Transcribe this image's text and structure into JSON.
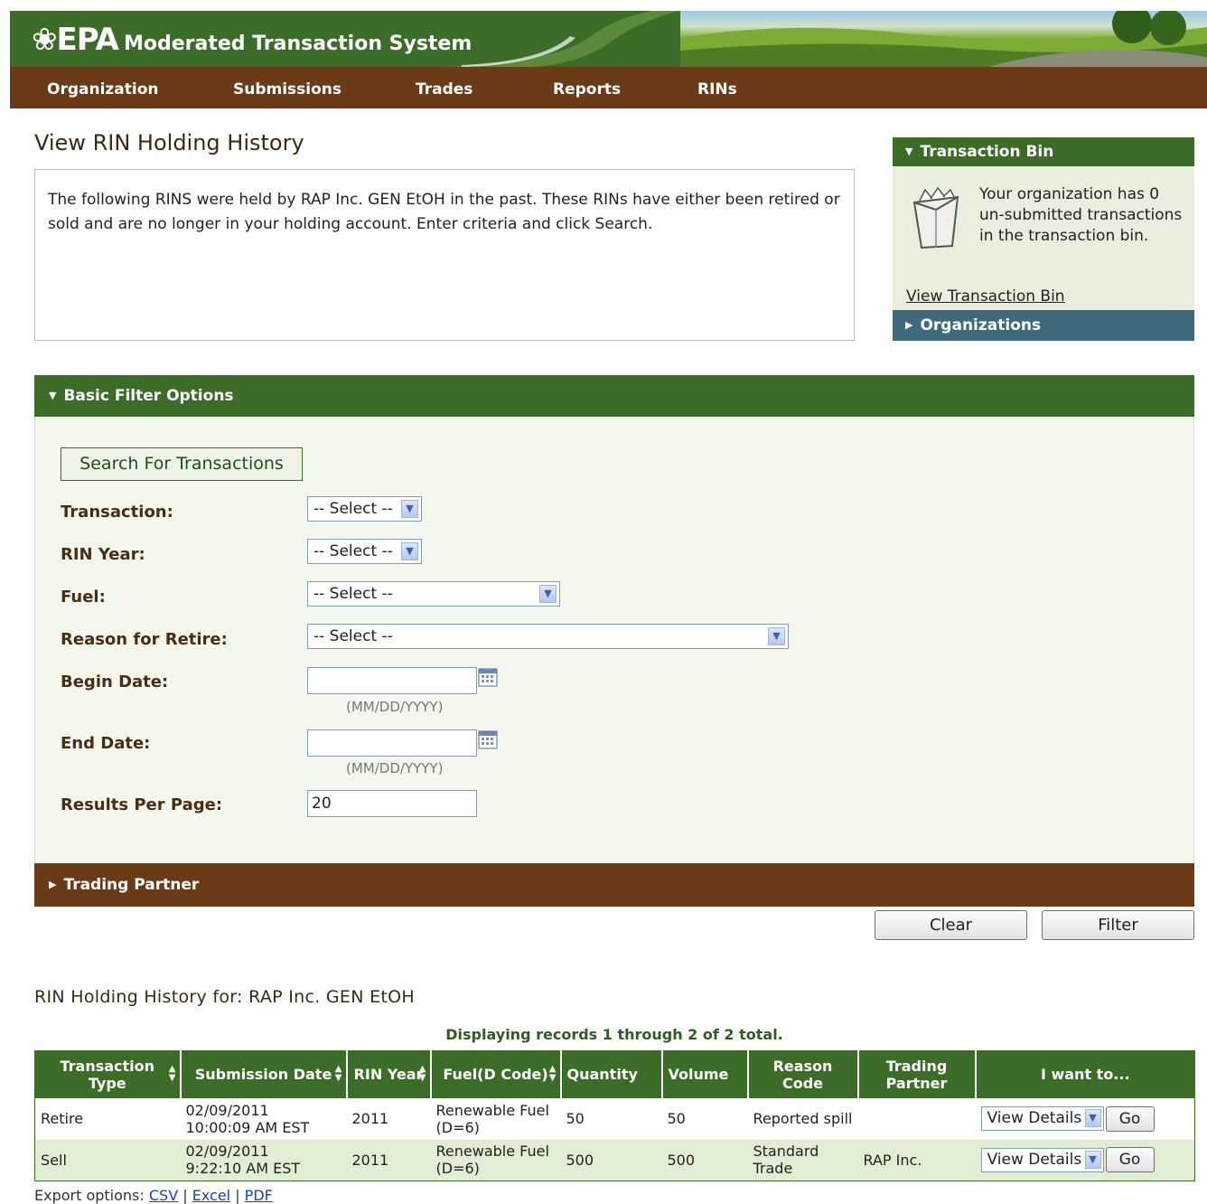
{
  "header": {
    "logo": "❀EPA",
    "site_title": "Moderated Transaction System",
    "nav": [
      "Organization",
      "Submissions",
      "Trades",
      "Reports",
      "RINs"
    ]
  },
  "page": {
    "title": "View RIN Holding History",
    "intro": "The following RINS were held by RAP Inc. GEN EtOH in the past. These RINs have either been retired or sold and are no longer in your holding account. Enter criteria and click Search."
  },
  "transaction_bin": {
    "title": "Transaction Bin",
    "message": "Your organization has 0 un-submitted transactions in the transaction bin.",
    "link": "View Transaction Bin"
  },
  "organizations": {
    "title": "Organizations"
  },
  "filter": {
    "title": "Basic Filter Options",
    "search_button": "Search For Transactions",
    "transaction_label": "Transaction:",
    "transaction_value": "-- Select --",
    "rin_year_label": "RIN Year:",
    "rin_year_value": "-- Select --",
    "fuel_label": "Fuel:",
    "fuel_value": "-- Select --",
    "reason_label": "Reason for Retire:",
    "reason_value": "-- Select --",
    "begin_label": "Begin Date:",
    "begin_value": "",
    "end_label": "End Date:",
    "end_value": "",
    "date_hint": "(MM/DD/YYYY)",
    "rpp_label": "Results Per Page:",
    "rpp_value": "20"
  },
  "trading_partner": {
    "title": "Trading Partner"
  },
  "buttons": {
    "clear": "Clear",
    "filter": "Filter"
  },
  "results": {
    "title": "RIN Holding History for: RAP Inc. GEN EtOH",
    "records_info": "Displaying records 1 through 2 of 2 total.",
    "columns": [
      "Transaction Type",
      "Submission Date",
      "RIN Year",
      "Fuel(D Code)",
      "Quantity",
      "Volume",
      "Reason Code",
      "Trading Partner",
      "I want to..."
    ],
    "rows": [
      {
        "type": "Retire",
        "date": "02/09/2011",
        "time": "10:00:09 AM EST",
        "year": "2011",
        "fuel": "Renewable Fuel (D=6)",
        "quantity": "50",
        "volume": "50",
        "reason": "Reported spill",
        "partner": "",
        "action": "View Details",
        "go": "Go"
      },
      {
        "type": "Sell",
        "date": "02/09/2011",
        "time": "9:22:10 AM EST",
        "year": "2011",
        "fuel": "Renewable Fuel (D=6)",
        "quantity": "500",
        "volume": "500",
        "reason": "Standard Trade",
        "partner": "RAP Inc.",
        "action": "View Details",
        "go": "Go"
      }
    ]
  },
  "export": {
    "label": "Export options:",
    "csv": "CSV",
    "excel": "Excel",
    "pdf": "PDF"
  }
}
